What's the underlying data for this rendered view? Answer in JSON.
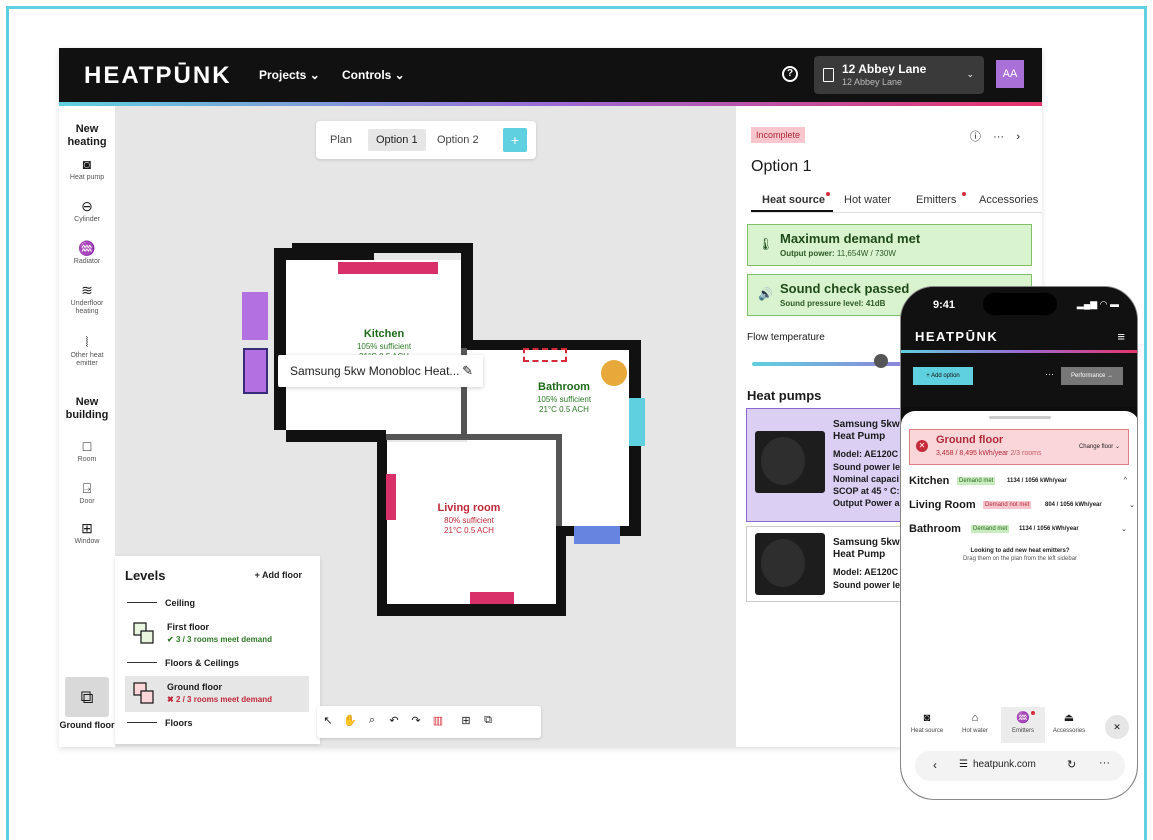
{
  "topbar": {
    "brand": "HEATPŪNK",
    "nav": [
      "Projects ⌄",
      "Controls ⌄"
    ],
    "project_title": "12 Abbey Lane",
    "project_sub": "12 Abbey Lane",
    "avatar": "AA"
  },
  "sidebar": {
    "new_heating": "New heating",
    "heating_items": [
      {
        "label": "Heat pump",
        "icon": "heat-pump-icon"
      },
      {
        "label": "Cylinder",
        "icon": "cylinder-icon"
      },
      {
        "label": "Radiator",
        "icon": "radiator-icon"
      },
      {
        "label": "Underfloor heating",
        "icon": "underfloor-heating-icon"
      },
      {
        "label": "Other heat emitter",
        "icon": "other-emitter-icon"
      }
    ],
    "new_building": "New building",
    "building_items": [
      {
        "label": "Room",
        "icon": "room-icon"
      },
      {
        "label": "Door",
        "icon": "door-icon"
      },
      {
        "label": "Window",
        "icon": "window-icon"
      }
    ],
    "ground_floor": "Ground floor"
  },
  "plan_tabs": [
    "Plan",
    "Option 1",
    "Option 2"
  ],
  "plan_tabs_active": "Option 1",
  "rooms": {
    "kitchen": {
      "name": "Kitchen",
      "sufficient": "105% sufficient",
      "details": "21°C 0.5 ACH"
    },
    "bathroom": {
      "name": "Bathroom",
      "sufficient": "105% sufficient",
      "details": "21°C  0.5 ACH"
    },
    "living": {
      "name": "Living room",
      "sufficient": "80% sufficient",
      "details": "21°C  0.5 ACH"
    }
  },
  "tooltip": "Samsung 5kw Monobloc Heat...",
  "levels": {
    "title": "Levels",
    "add_floor": "+  Add floor",
    "ceiling": "Ceiling",
    "first_floor": "First floor",
    "first_status": "3 / 3 rooms meet demand",
    "floors_ceilings": "Floors & Ceilings",
    "ground_floor": "Ground floor",
    "ground_status": "2 / 3 rooms meet demand",
    "floors": "Floors"
  },
  "right_panel": {
    "status": "Incomplete",
    "option_title": "Option 1",
    "tabs": [
      "Heat source",
      "Hot water",
      "Emitters",
      "Accessories"
    ],
    "demand_title": "Maximum demand met",
    "demand_label": "Output power:",
    "demand_value": "11,654W / 730W",
    "sound_title": "Sound check passed",
    "sound_label": "Sound pressure level:",
    "sound_value": "41dB",
    "flow_label": "Flow temperature",
    "heat_pumps_title": "Heat pumps",
    "hp1": {
      "name1": "Samsung 5kw",
      "name2": "Heat Pump",
      "model": "Model: AE120C",
      "l1": "Sound power le",
      "l2": "Nominal capaci",
      "l3": "SCOP at 45 ° C:",
      "l4": "Output Power a"
    },
    "hp2": {
      "name1": "Samsung 5kw",
      "name2": "Heat Pump",
      "model": "Model: AE120C",
      "l1": "Sound power le"
    }
  },
  "phone": {
    "time": "9:41",
    "brand": "HEATPŪNK",
    "add_option": "+ Add option",
    "performance": "Performance →",
    "gf_title": "Ground floor",
    "gf_value": "3,458 / 8,495 kWh/year",
    "gf_rooms": "2/3 rooms",
    "change_floor": "Change floor ⌄",
    "rooms": [
      {
        "name": "Kitchen",
        "badge": "Demand met",
        "value": "1134 / 1056 kWh/year",
        "caret": "^"
      },
      {
        "name": "Living Room",
        "badge": "Demand not met",
        "value": "804 / 1056 kWh/year",
        "caret": "⌄"
      },
      {
        "name": "Bathroom",
        "badge": "Demand met",
        "value": "1134 / 1056 kWh/year",
        "caret": "⌄"
      }
    ],
    "hint_title": "Looking to add new heat emitters?",
    "hint_sub": "Drag them on the plan from the left sidebar",
    "nav": [
      "Heat source",
      "Hot water",
      "Emitters",
      "Accessories"
    ],
    "url": "heatpunk.com"
  },
  "colors": {
    "accent": "#5fd0df",
    "purple": "#a970d8",
    "red": "#d42a3a",
    "green_card": "#d9f3cf"
  }
}
